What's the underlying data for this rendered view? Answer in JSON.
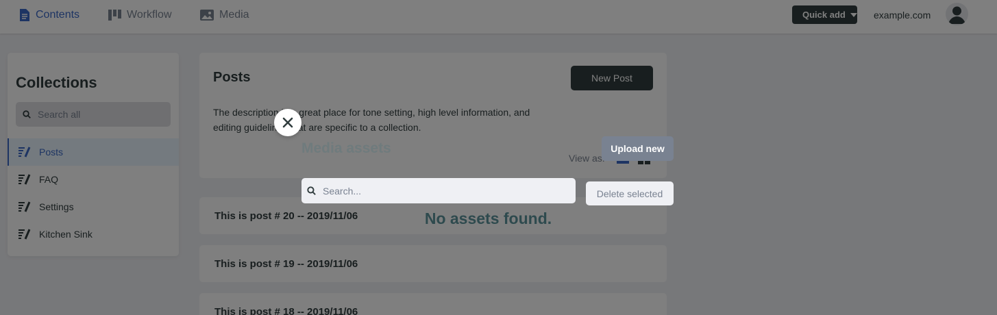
{
  "topbar": {
    "nav": [
      {
        "label": "Contents",
        "icon": "document-icon"
      },
      {
        "label": "Workflow",
        "icon": "workflow-icon"
      },
      {
        "label": "Media",
        "icon": "image-icon"
      }
    ],
    "quick_add_label": "Quick add",
    "site_url": "example.com"
  },
  "sidebar": {
    "title": "Collections",
    "search_placeholder": "Search all",
    "items": [
      {
        "label": "Posts",
        "active": true
      },
      {
        "label": "FAQ"
      },
      {
        "label": "Settings"
      },
      {
        "label": "Kitchen Sink"
      }
    ]
  },
  "collection": {
    "title": "Posts",
    "new_button": "New Post",
    "description": "The description is a great place for tone setting, high level information, and editing guidelines that are specific to a collection.",
    "view_as_label": "View as:"
  },
  "posts": [
    "This is post # 20 -- 2019/11/06",
    "This is post # 19 -- 2019/11/06",
    "This is post # 18 -- 2019/11/06"
  ],
  "media_modal": {
    "title": "Media assets",
    "upload_label": "Upload new",
    "search_placeholder": "Search...",
    "delete_label": "Delete selected",
    "empty_message": "No assets found."
  },
  "colors": {
    "accent": "#3a69c7",
    "dark": "#313d3e",
    "muted": "#798291",
    "overlay": "rgba(0,0,0,0.5)"
  }
}
